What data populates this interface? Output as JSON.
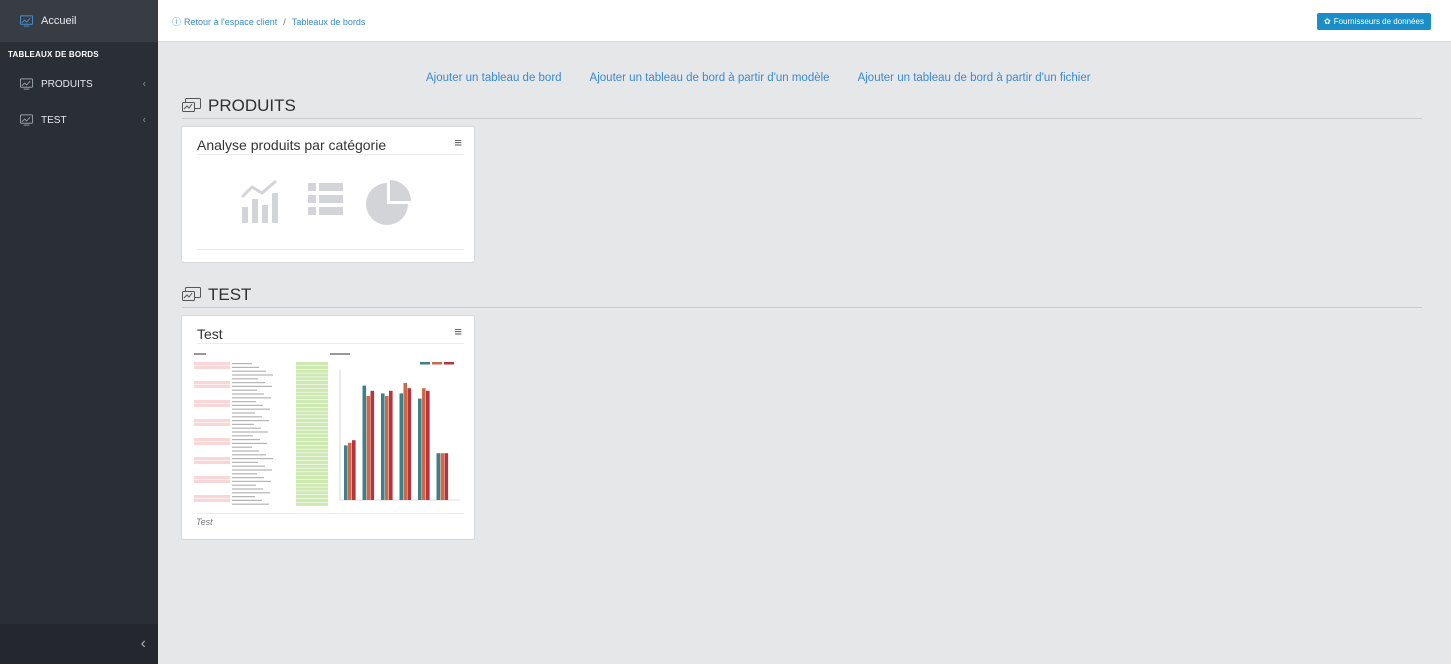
{
  "sidebar": {
    "home_label": "Accueil",
    "section_label": "TABLEAUX DE BORDS",
    "items": [
      {
        "label": "PRODUITS",
        "icon": "dashboard-icon"
      },
      {
        "label": "TEST",
        "icon": "dashboard-icon"
      }
    ],
    "collapse_icon": "chevron-left-icon"
  },
  "topbar": {
    "breadcrumb": [
      "Retour à l'espace client",
      "Tableaux de bords"
    ],
    "providers_button": "Fournisseurs de données"
  },
  "actions": [
    "Ajouter un tableau de bord",
    "Ajouter un tableau de bord à partir d'un modèle",
    "Ajouter un tableau de bord à partir d'un fichier"
  ],
  "sections": [
    {
      "title": "PRODUITS",
      "cards": [
        {
          "title": "Analyse produits par catégorie",
          "description": ""
        }
      ]
    },
    {
      "title": "TEST",
      "cards": [
        {
          "title": "Test",
          "description": "Test"
        }
      ]
    }
  ],
  "colors": {
    "accent": "#1b8ec9",
    "link": "#3a8ad0",
    "sidebar_bg": "#2a2e35",
    "placeholder_icon": "#d2d4d7",
    "bar_series": [
      "#3e7f8c",
      "#c96a4a",
      "#b8343a"
    ]
  },
  "thumbnail": {
    "bar_values": [
      [
        0.42,
        0.44,
        0.46
      ],
      [
        0.88,
        0.8,
        0.84
      ],
      [
        0.82,
        0.8,
        0.84
      ],
      [
        0.82,
        0.9,
        0.86
      ],
      [
        0.78,
        0.86,
        0.84
      ],
      [
        0.36,
        0.36,
        0.36
      ]
    ]
  }
}
